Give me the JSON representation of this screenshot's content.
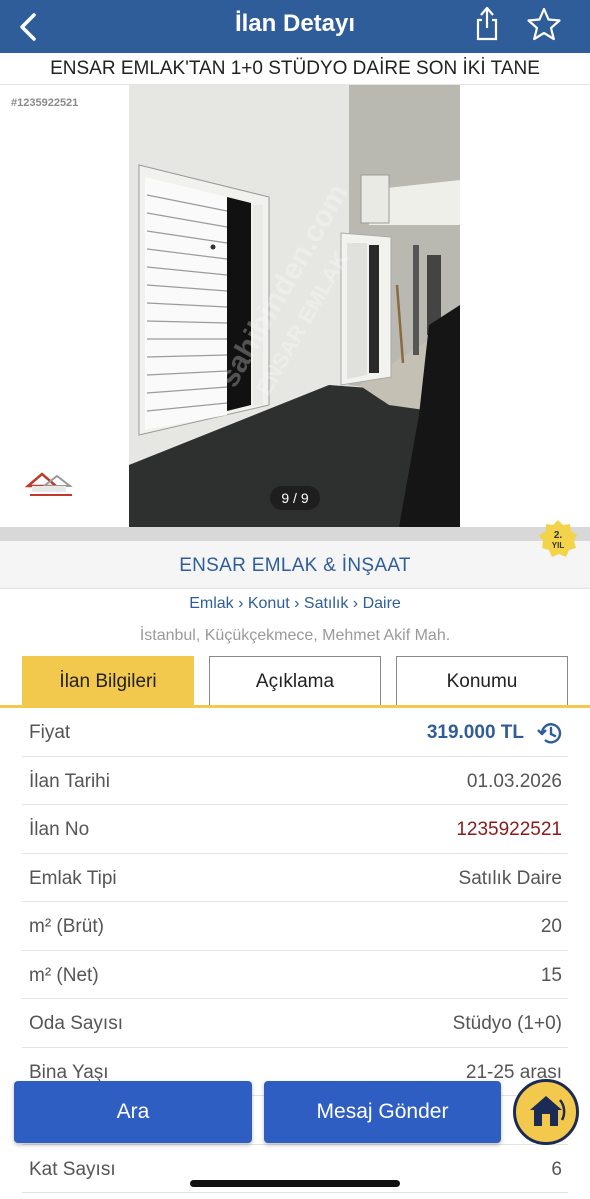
{
  "header": {
    "title": "İlan Detayı"
  },
  "listing": {
    "title": "ENSAR EMLAK'TAN 1+0 STÜDYO DAİRE SON İKİ TANE",
    "ad_id_label": "#1235922521",
    "photo_counter": "9 / 9",
    "watermark": "sahibinden.com ENSAR EMLAK"
  },
  "store": {
    "name": "ENSAR EMLAK & İNŞAAT",
    "badge_num": "2.",
    "badge_text": "YIL"
  },
  "breadcrumb": "Emlak › Konut › Satılık › Daire",
  "location": "İstanbul, Küçükçekmece, Mehmet Akif Mah.",
  "tabs": [
    {
      "label": "İlan Bilgileri",
      "active": true
    },
    {
      "label": "Açıklama",
      "active": false
    },
    {
      "label": "Konumu",
      "active": false
    }
  ],
  "info": [
    {
      "key": "Fiyat",
      "value": "319.000 TL"
    },
    {
      "key": "İlan Tarihi",
      "value": "01.03.2026"
    },
    {
      "key": "İlan No",
      "value": "1235922521"
    },
    {
      "key": "Emlak Tipi",
      "value": "Satılık Daire"
    },
    {
      "key": "m² (Brüt)",
      "value": "20"
    },
    {
      "key": "m² (Net)",
      "value": "15"
    },
    {
      "key": "Oda Sayısı",
      "value": "Stüdyo (1+0)"
    },
    {
      "key": "Bina Yaşı",
      "value": "21-25 arası"
    },
    {
      "key": "",
      "value": ""
    },
    {
      "key": "Kat Sayısı",
      "value": "6"
    }
  ],
  "actions": {
    "search": "Ara",
    "message": "Mesaj Gönder"
  },
  "colors": {
    "header_bg": "#2f5d99",
    "tab_active": "#f2c94c",
    "button_bg": "#2f5ec2",
    "ad_no": "#8b1a1a"
  }
}
